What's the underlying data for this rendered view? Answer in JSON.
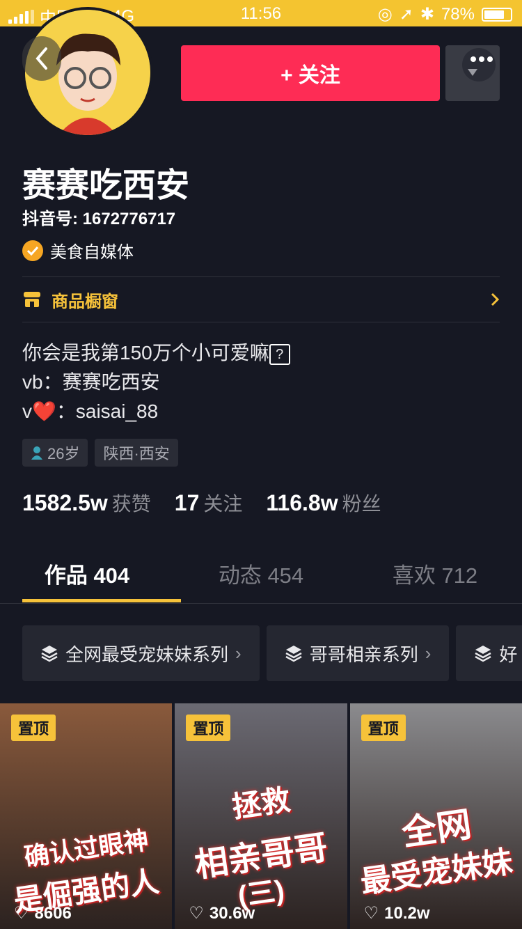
{
  "status_bar": {
    "carrier": "中国移动",
    "network": "4G",
    "time": "11:56",
    "battery": "78%",
    "battery_level": 0.78
  },
  "profile": {
    "follow_label": "+ 关注",
    "name": "赛赛吃西安",
    "douyin_id": "抖音号: 1672776717",
    "verified_label": "美食自媒体",
    "shop_label": "商品橱窗",
    "bio_lines": [
      "你会是我第150万个小可爱嘛",
      "vb：赛赛吃西安",
      "v",
      "：saisai_88"
    ],
    "tags": [
      "26岁",
      "陕西·西安"
    ],
    "stats": [
      {
        "value": "1582.5w",
        "label": "获赞"
      },
      {
        "value": "17",
        "label": "关注"
      },
      {
        "value": "116.8w",
        "label": "粉丝"
      }
    ]
  },
  "tabs": [
    {
      "label": "作品 404"
    },
    {
      "label": "动态 454"
    },
    {
      "label": "喜欢 712"
    }
  ],
  "series": [
    "全网最受宠妹妹系列",
    "哥哥相亲系列",
    "好"
  ],
  "videos": [
    {
      "pin": "置顶",
      "caption1": "确认过眼神",
      "caption2": "是倔强的人",
      "likes": "8606",
      "bg": "#8a5a3c"
    },
    {
      "pin": "置顶",
      "caption1": "拯救",
      "caption2": "相亲哥哥",
      "caption3": "(三)",
      "likes": "30.6w",
      "bg": "#6b6a73"
    },
    {
      "pin": "置顶",
      "caption1": "全网",
      "caption2": "最受宠妹妹",
      "likes": "10.2w",
      "bg": "#8b8b8e"
    }
  ]
}
